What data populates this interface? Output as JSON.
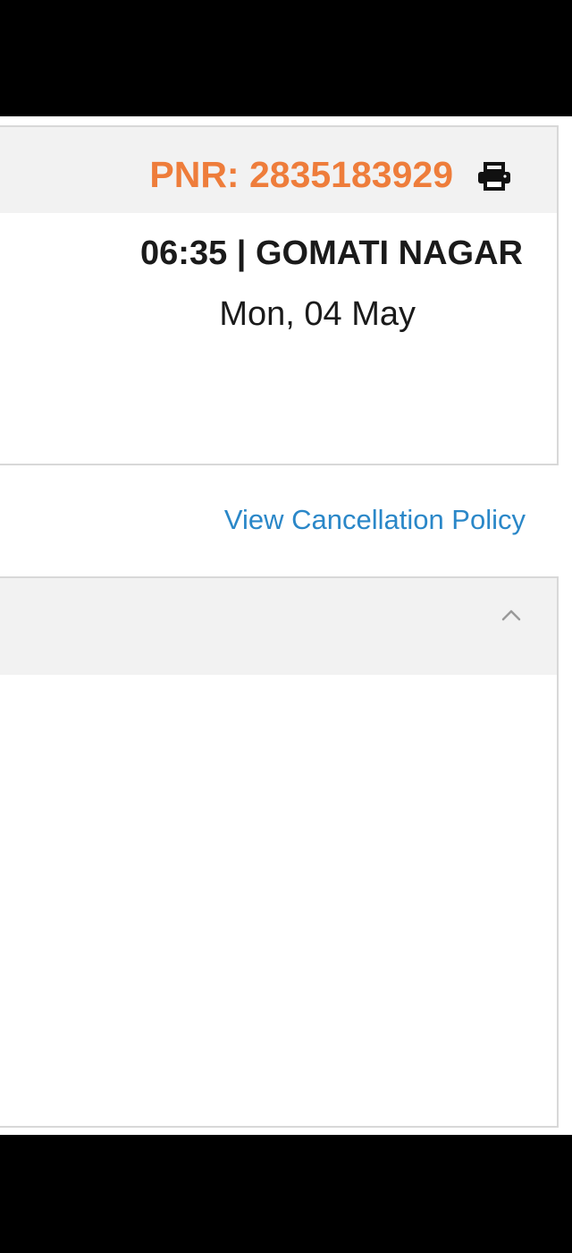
{
  "booking": {
    "pnr_label": "PNR: 2835183929",
    "departure": "06:35 | GOMATI NAGAR",
    "date": "Mon, 04 May"
  },
  "links": {
    "cancellation_policy": "View Cancellation Policy"
  },
  "icons": {
    "print": "print-icon",
    "collapse": "chevron-up-icon"
  },
  "colors": {
    "pnr": "#ee7d3b",
    "link": "#2a87c8",
    "header_bg": "#f2f2f2",
    "border": "#d8d8d8"
  }
}
